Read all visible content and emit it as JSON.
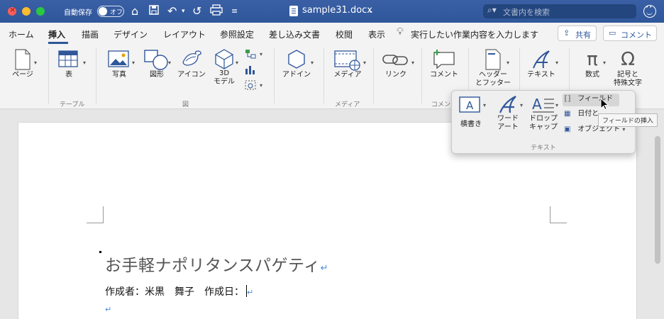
{
  "window": {
    "autosave_label": "自動保存",
    "autosave_state": "オフ",
    "filename": "sample31.docx",
    "search_placeholder": "文書内を検索"
  },
  "tabs": {
    "items": [
      "ホーム",
      "挿入",
      "描画",
      "デザイン",
      "レイアウト",
      "参照設定",
      "差し込み文書",
      "校閲",
      "表示"
    ],
    "active": "挿入",
    "tell_me": "実行したい作業内容を入力します",
    "share_label": "共有",
    "comment_label": "コメント"
  },
  "ribbon": {
    "page": "ページ",
    "table": "表",
    "photo": "写真",
    "shape": "図形",
    "icon": "アイコン",
    "model3d_1": "3D",
    "model3d_2": "モデル",
    "addin": "アドイン",
    "media": "メディア",
    "link": "リンク",
    "comment": "コメント",
    "header_1": "ヘッダー",
    "header_2": "とフッター",
    "text": "テキスト",
    "equation": "数式",
    "symbol_1": "記号と",
    "symbol_2": "特殊文字",
    "groups": {
      "table": "テーブル",
      "illustrations": "図",
      "media": "メディア",
      "comments": "コメン"
    }
  },
  "text_popup": {
    "textbox": "横書き",
    "wordart_1": "ワード",
    "wordart_2": "アート",
    "dropcap_1": "ドロップ",
    "dropcap_2": "キャップ",
    "field": "フィールド",
    "datetime": "日付と",
    "object": "オブジェクト",
    "group_label": "テキスト",
    "tooltip": "フィールドの挿入"
  },
  "document": {
    "title": "お手軽ナポリタンスパゲティ",
    "line2": "作成者：米黒　舞子　作成日：",
    "para_mark": "↵"
  },
  "colors": {
    "titlebar": "#2f579a",
    "ribbon_icon": "#2f579a",
    "para_mark": "#4a8ad8"
  }
}
